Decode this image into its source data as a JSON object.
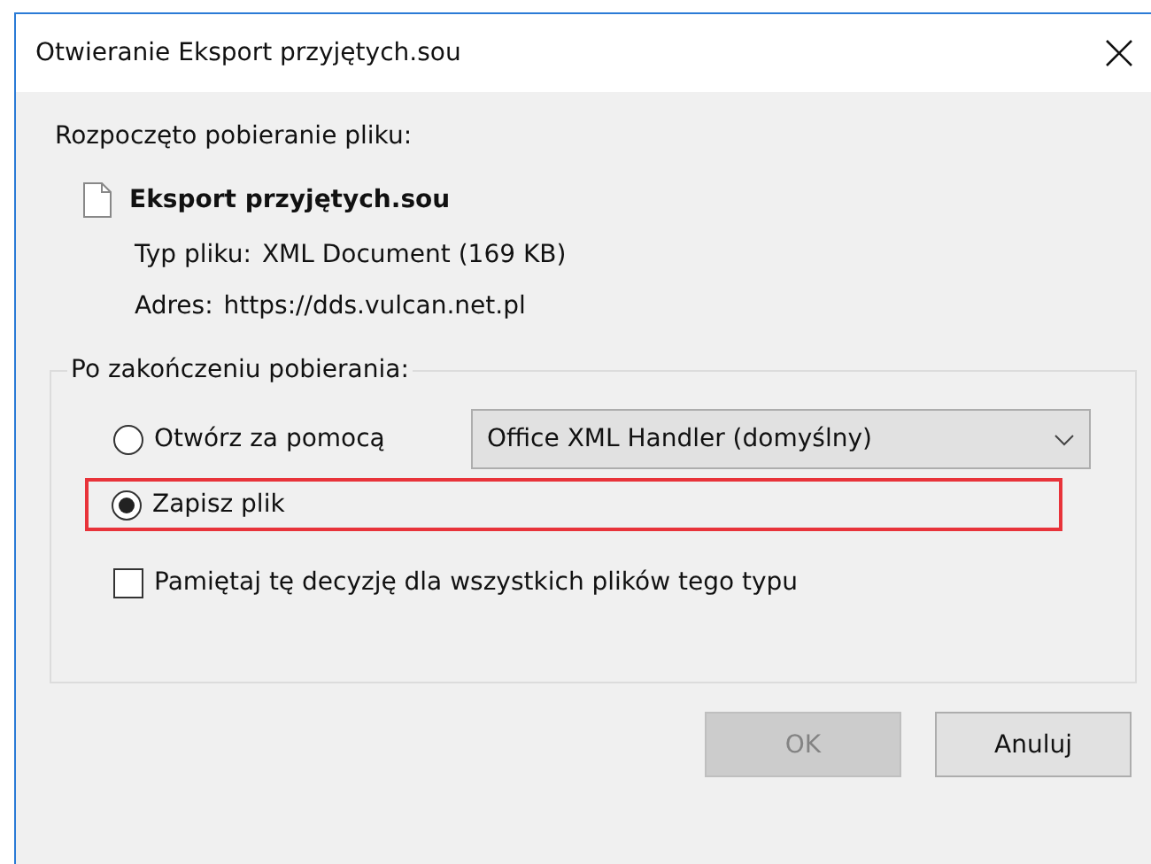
{
  "window": {
    "title": "Otwieranie Eksport przyjętych.sou"
  },
  "intro": "Rozpoczęto pobieranie pliku:",
  "file": {
    "name": "Eksport przyjętych.sou",
    "type_label": "Typ pliku:",
    "type_value": "XML Document (169 KB)",
    "address_label": "Adres:",
    "address_value": "https://dds.vulcan.net.pl"
  },
  "group": {
    "legend": "Po zakończeniu pobierania:",
    "options": [
      {
        "label": "Otwórz za pomocą",
        "selected": false,
        "highlighted": false,
        "dropdown": "Office XML Handler (domyślny)"
      },
      {
        "label": "Zapisz plik",
        "selected": true,
        "highlighted": true
      }
    ],
    "remember": {
      "label": "Pamiętaj tę decyzję dla wszystkich plików tego typu",
      "checked": false
    }
  },
  "buttons": [
    {
      "label": "OK",
      "disabled": true
    },
    {
      "label": "Anuluj",
      "disabled": false
    }
  ]
}
